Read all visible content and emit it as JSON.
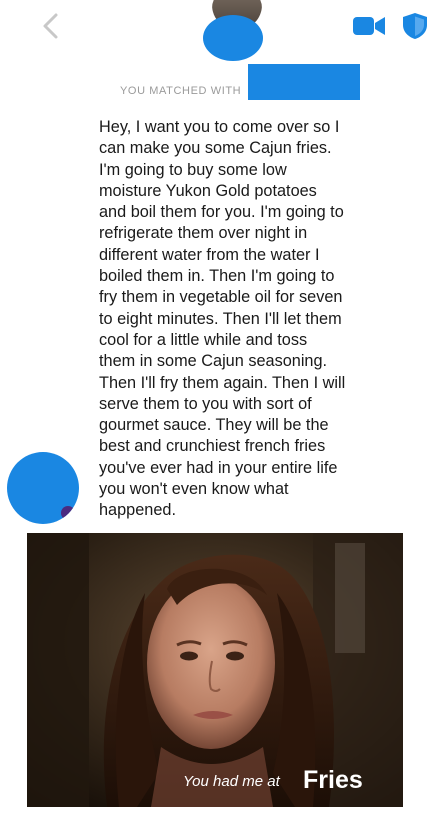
{
  "header": {
    "back_icon": "chevron-left-icon",
    "video_icon": "video-camera-icon",
    "safety_icon": "shield-icon",
    "accent_color": "#1a87e2"
  },
  "match_banner": {
    "text": "YOU MATCHED WITH"
  },
  "message": {
    "text": "Hey, I want you to come over so I\ncan make you some Cajun fries.\nI'm going to buy some low\nmoisture Yukon Gold potatoes\nand boil them for you. I'm going to\nrefrigerate them over night in\ndifferent water from the water I\nboiled them in. Then I'm going to\nfry them in vegetable oil for seven\nto eight minutes. Then I'll let them\ncool for a little while and toss\nthem in some Cajun seasoning.\nThen I'll fry them again. Then I will\nserve them to you with sort of\ngourmet sauce. They will be the\nbest and crunchiest french fries\nyou've ever had in your entire life\nyou won't even know what\nhappened."
  },
  "gif": {
    "caption": "You had me at",
    "highlight": "Fries"
  }
}
